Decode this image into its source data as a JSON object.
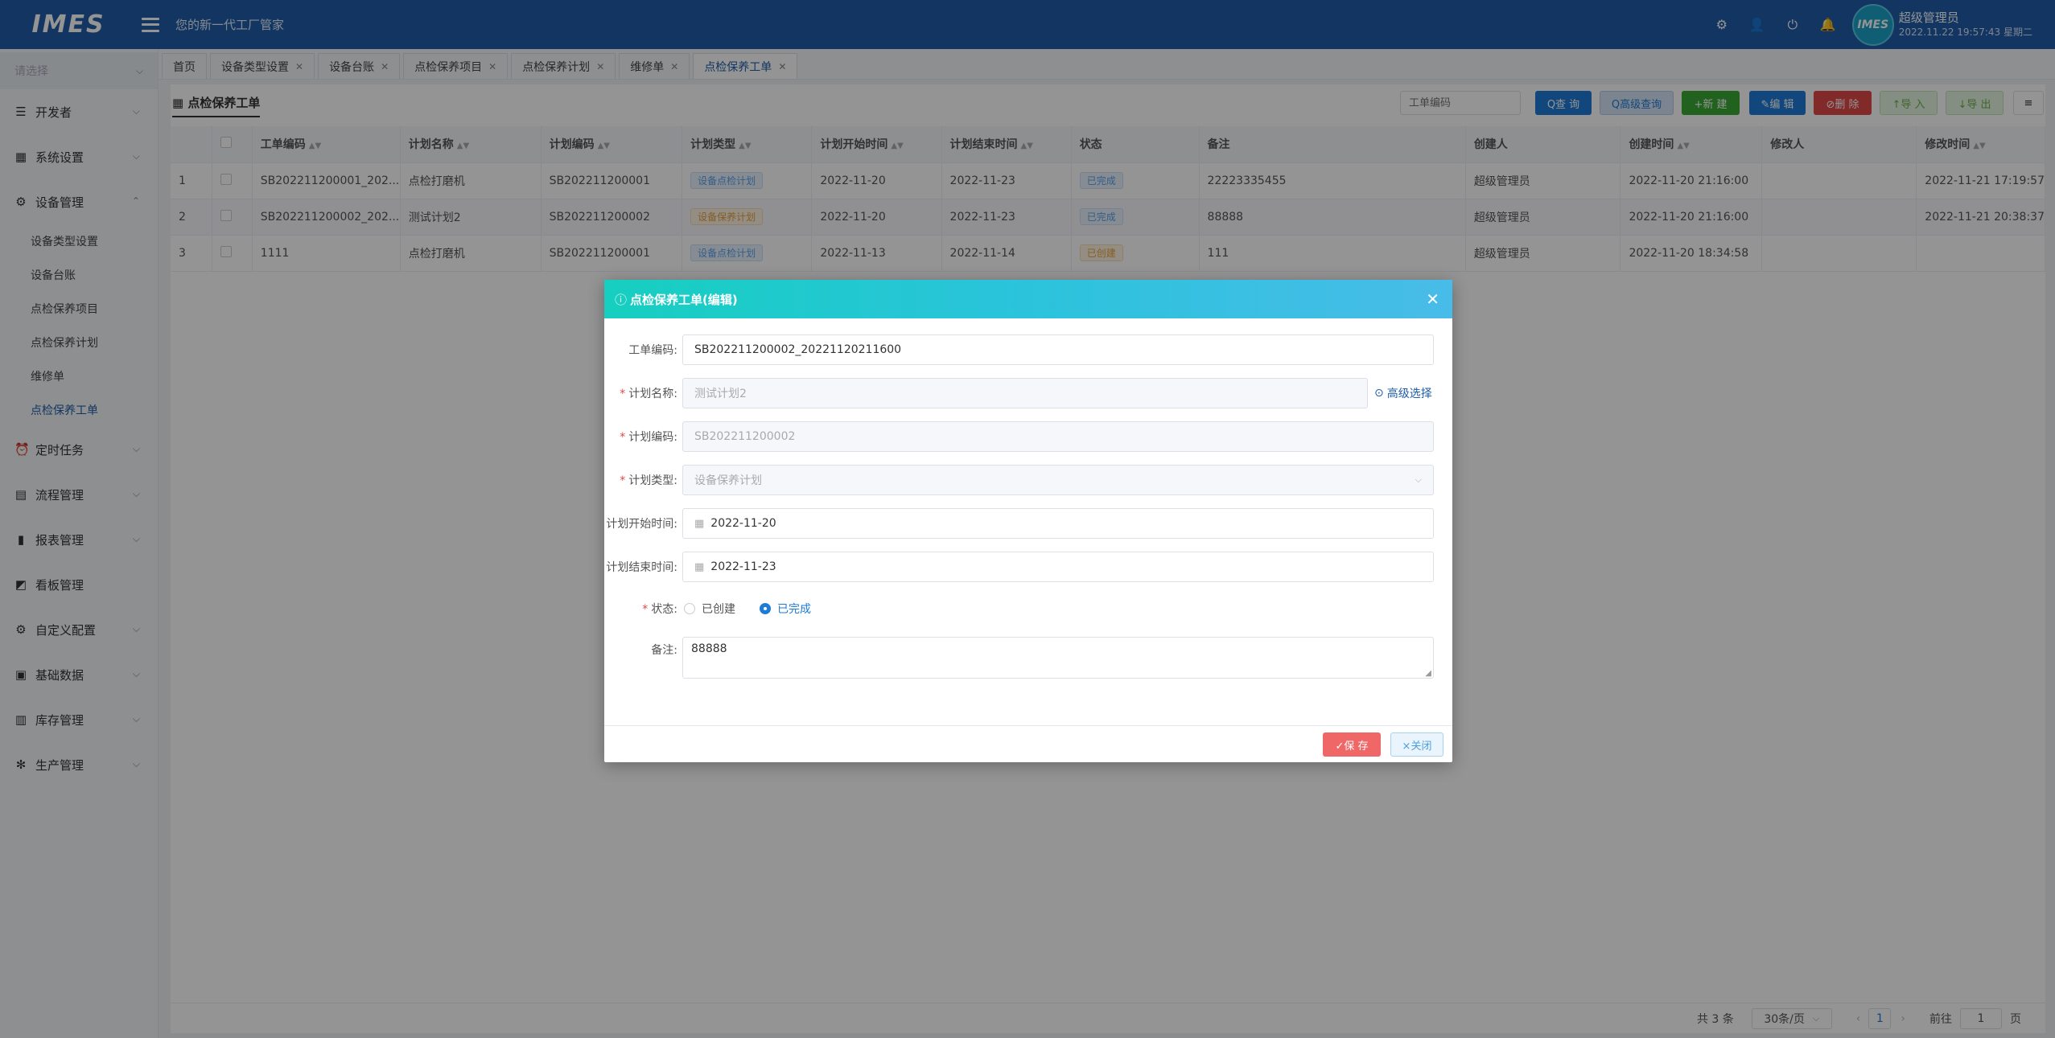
{
  "header": {
    "logo": "IMES",
    "slogan": "您的新一代工厂管家",
    "user_name": "超级管理员",
    "user_time": "2022.11.22 19:57:43 星期二",
    "avatar_text": "IMES"
  },
  "sidebar": {
    "select_placeholder": "请选择",
    "items": [
      {
        "label": "开发者",
        "icon": "sliders-icon"
      },
      {
        "label": "系统设置",
        "icon": "grid-icon"
      },
      {
        "label": "设备管理",
        "icon": "gear-icon"
      },
      {
        "label": "定时任务",
        "icon": "clock-icon"
      },
      {
        "label": "流程管理",
        "icon": "flow-icon"
      },
      {
        "label": "报表管理",
        "icon": "bar-chart-icon"
      },
      {
        "label": "看板管理",
        "icon": "board-icon"
      },
      {
        "label": "自定义配置",
        "icon": "gear-icon"
      },
      {
        "label": "基础数据",
        "icon": "book-icon"
      },
      {
        "label": "库存管理",
        "icon": "inventory-icon"
      },
      {
        "label": "生产管理",
        "icon": "cog-icon"
      }
    ],
    "subitems": [
      "设备类型设置",
      "设备台账",
      "点检保养项目",
      "点检保养计划",
      "维修单",
      "点检保养工单"
    ]
  },
  "tabs": [
    {
      "label": "首页"
    },
    {
      "label": "设备类型设置"
    },
    {
      "label": "设备台账"
    },
    {
      "label": "点检保养项目"
    },
    {
      "label": "点检保养计划"
    },
    {
      "label": "维修单"
    },
    {
      "label": "点检保养工单"
    }
  ],
  "page": {
    "title": "点检保养工单",
    "search_placeholder": "工单编码",
    "buttons": {
      "query": "Q查 询",
      "advanced_query": "Q高级查询",
      "new": "+新 建",
      "edit": "✎编 辑",
      "delete": "⊘删 除",
      "import": "↑导 入",
      "export": "↓导 出",
      "menu": "≡"
    }
  },
  "table": {
    "headers": [
      "工单编码",
      "计划名称",
      "计划编码",
      "计划类型",
      "计划开始时间",
      "计划结束时间",
      "状态",
      "备注",
      "创建人",
      "创建时间",
      "修改人",
      "修改时间"
    ],
    "rows": [
      {
        "no": "1",
        "code": "SB202211200001_202...",
        "plan_name": "点检打磨机",
        "plan_code": "SB202211200001",
        "plan_type": "设备点检计划",
        "start": "2022-11-20",
        "end": "2022-11-23",
        "status": "已完成",
        "remark": "22223335455",
        "creator": "超级管理员",
        "created": "2022-11-20 21:16:00",
        "modifier": "",
        "modified": "2022-11-21 17:19:57"
      },
      {
        "no": "2",
        "code": "SB202211200002_202...",
        "plan_name": "测试计划2",
        "plan_code": "SB202211200002",
        "plan_type": "设备保养计划",
        "start": "2022-11-20",
        "end": "2022-11-23",
        "status": "已完成",
        "remark": "88888",
        "creator": "超级管理员",
        "created": "2022-11-20 21:16:00",
        "modifier": "",
        "modified": "2022-11-21 20:38:37"
      },
      {
        "no": "3",
        "code": "1111",
        "plan_name": "点检打磨机",
        "plan_code": "SB202211200001",
        "plan_type": "设备点检计划",
        "start": "2022-11-13",
        "end": "2022-11-14",
        "status": "已创建",
        "remark": "111",
        "creator": "超级管理员",
        "created": "2022-11-20 18:34:58",
        "modifier": "",
        "modified": ""
      }
    ]
  },
  "pager": {
    "total": "共 3 条",
    "page_size": "30条/页",
    "current": "1",
    "goto_label": "前往",
    "goto_value": "1",
    "page_unit": "页"
  },
  "modal": {
    "title": "点检保养工单(编辑)",
    "fields": {
      "code_label": "工单编码:",
      "code_value": "SB202211200002_20221120211600",
      "plan_name_label": "计划名称:",
      "plan_name_value": "测试计划2",
      "advanced_select": "高级选择",
      "plan_code_label": "计划编码:",
      "plan_code_value": "SB202211200002",
      "plan_type_label": "计划类型:",
      "plan_type_value": "设备保养计划",
      "start_label": "计划开始时间:",
      "start_value": "2022-11-20",
      "end_label": "计划结束时间:",
      "end_value": "2022-11-23",
      "status_label": "状态:",
      "status_options": [
        "已创建",
        "已完成"
      ],
      "status_selected": "已完成",
      "remark_label": "备注:",
      "remark_value": "88888"
    },
    "save": "✓保 存",
    "close": "×关闭"
  },
  "colors": {
    "header_bg": "#1f5ea8",
    "accent": "#1e7bd6",
    "modal_head_start": "#16cfc0",
    "modal_head_end": "#48bce8",
    "save_btn": "#f06767"
  }
}
